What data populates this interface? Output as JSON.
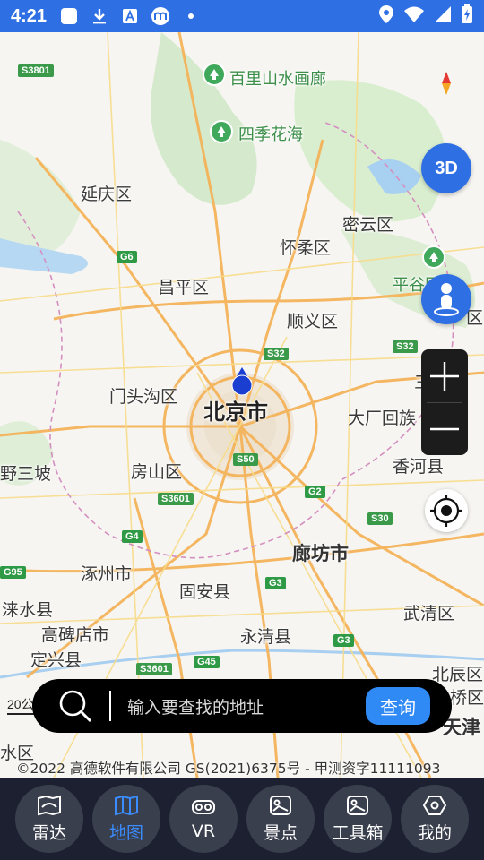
{
  "status_bar": {
    "time": "4:21"
  },
  "map": {
    "places": [
      {
        "id": "baili",
        "label": "百里山水画廊",
        "cls": "green"
      },
      {
        "id": "siji",
        "label": "四季花海",
        "cls": "green"
      },
      {
        "id": "yanqing",
        "label": "延庆区",
        "cls": ""
      },
      {
        "id": "miyun",
        "label": "密云区",
        "cls": ""
      },
      {
        "id": "huairou",
        "label": "怀柔区",
        "cls": ""
      },
      {
        "id": "changping",
        "label": "昌平区",
        "cls": ""
      },
      {
        "id": "pinggu",
        "label": "平谷区",
        "cls": ""
      },
      {
        "id": "shunyi",
        "label": "顺义区",
        "cls": ""
      },
      {
        "id": "mentougou",
        "label": "门头沟区",
        "cls": ""
      },
      {
        "id": "beijing",
        "label": "北京市",
        "cls": "big"
      },
      {
        "id": "dachang",
        "label": "大厂回族",
        "cls": ""
      },
      {
        "id": "sanhe",
        "label": "三",
        "cls": ""
      },
      {
        "id": "yesanpo",
        "label": "野三坡",
        "cls": ""
      },
      {
        "id": "fangshan",
        "label": "房山区",
        "cls": ""
      },
      {
        "id": "xianghe",
        "label": "香河县",
        "cls": ""
      },
      {
        "id": "langfang",
        "label": "廊坊市",
        "cls": "mid"
      },
      {
        "id": "zhuozhou",
        "label": "涿州市",
        "cls": ""
      },
      {
        "id": "gu_an",
        "label": "固安县",
        "cls": ""
      },
      {
        "id": "laishui",
        "label": "涞水县",
        "cls": ""
      },
      {
        "id": "wuqing",
        "label": "武清区",
        "cls": ""
      },
      {
        "id": "gaobeidian",
        "label": "高碑店市",
        "cls": ""
      },
      {
        "id": "yongqing",
        "label": "永清县",
        "cls": ""
      },
      {
        "id": "dingxing",
        "label": "定兴县",
        "cls": ""
      },
      {
        "id": "beichen",
        "label": "北辰区",
        "cls": ""
      },
      {
        "id": "qiao",
        "label": "桥区",
        "cls": ""
      },
      {
        "id": "tianjin",
        "label": "天津",
        "cls": "mid"
      },
      {
        "id": "shui",
        "label": "水区",
        "cls": ""
      },
      {
        "id": "qu_right",
        "label": "区",
        "cls": ""
      }
    ],
    "road_shields": [
      {
        "id": "s3801",
        "label": "S3801",
        "type": "s"
      },
      {
        "id": "g6",
        "label": "G6",
        "type": "g"
      },
      {
        "id": "s32a",
        "label": "S32",
        "type": "s"
      },
      {
        "id": "s32b",
        "label": "S32",
        "type": "s"
      },
      {
        "id": "s50",
        "label": "S50",
        "type": "s"
      },
      {
        "id": "s3601a",
        "label": "S3601",
        "type": "s"
      },
      {
        "id": "g2",
        "label": "G2",
        "type": "g"
      },
      {
        "id": "s30",
        "label": "S30",
        "type": "s"
      },
      {
        "id": "g4",
        "label": "G4",
        "type": "g"
      },
      {
        "id": "g95",
        "label": "G95",
        "type": "g"
      },
      {
        "id": "g3a",
        "label": "G3",
        "type": "g"
      },
      {
        "id": "g3b",
        "label": "G3",
        "type": "g"
      },
      {
        "id": "s3601b",
        "label": "S3601",
        "type": "s"
      },
      {
        "id": "g45",
        "label": "G45",
        "type": "g"
      }
    ],
    "scale_label": "20公",
    "copyright": "©2022 高德软件有限公司 GS(2021)6375号 - 甲测资字11111093"
  },
  "controls": {
    "btn_3d": "3D",
    "zoom_in": "+",
    "zoom_out": "−"
  },
  "search": {
    "placeholder": "输入要查找的地址",
    "submit_label": "查询"
  },
  "nav": {
    "items": [
      {
        "label": "雷达",
        "icon": "radar-icon",
        "active": false
      },
      {
        "label": "地图",
        "icon": "map-icon",
        "active": true
      },
      {
        "label": "VR",
        "icon": "vr-icon",
        "active": false
      },
      {
        "label": "景点",
        "icon": "scenic-icon",
        "active": false
      },
      {
        "label": "工具箱",
        "icon": "toolbox-icon",
        "active": false
      },
      {
        "label": "我的",
        "icon": "profile-icon",
        "active": false
      }
    ]
  },
  "colors": {
    "status_bar": "#2f6fe4",
    "accent": "#2f6fe4",
    "nav_bg": "#1c2031",
    "active_nav": "#3b8cff"
  }
}
